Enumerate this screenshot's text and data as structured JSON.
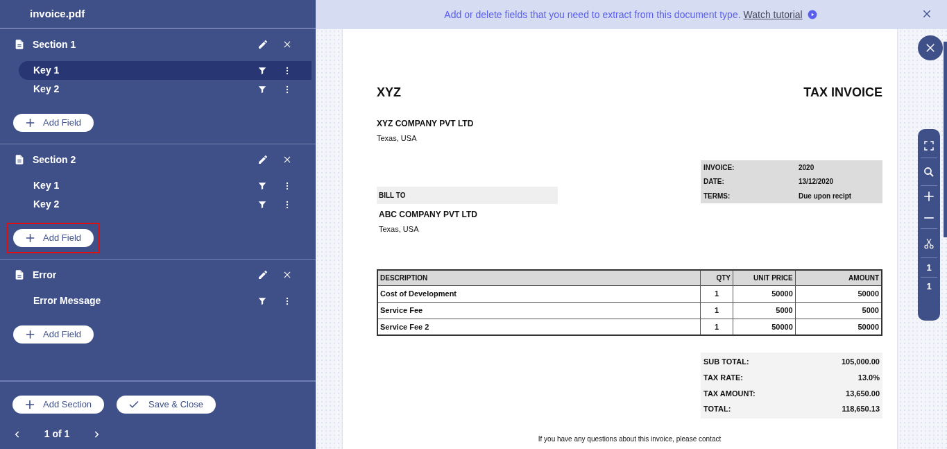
{
  "file_name": "invoice.pdf",
  "sections": [
    {
      "title": "Section 1",
      "keys": [
        {
          "label": "Key 1",
          "selected": true
        },
        {
          "label": "Key 2",
          "selected": false
        }
      ],
      "add_field": {
        "label": "Add Field",
        "highlighted": false
      }
    },
    {
      "title": "Section 2",
      "keys": [
        {
          "label": "Key 1",
          "selected": false
        },
        {
          "label": "Key 2",
          "selected": false
        }
      ],
      "add_field": {
        "label": "Add Field",
        "highlighted": true
      }
    },
    {
      "title": "Error",
      "keys": [
        {
          "label": "Error Message",
          "selected": false
        }
      ],
      "add_field": {
        "label": "Add Field",
        "highlighted": false
      }
    }
  ],
  "footer": {
    "add_section": "Add Section",
    "save_close": "Save & Close",
    "pager": "1 of 1"
  },
  "banner": {
    "message": "Add or delete fields that you need to extract from this document type.",
    "link": "Watch tutorial"
  },
  "toolbar": {
    "page_current": "1",
    "page_total": "1"
  },
  "document": {
    "title": "XYZ",
    "doc_type": "TAX INVOICE",
    "seller": {
      "name": "XYZ COMPANY PVT LTD",
      "address": "Texas, USA"
    },
    "info": [
      {
        "label": "INVOICE:",
        "value": "2020"
      },
      {
        "label": "DATE:",
        "value": "13/12/2020"
      },
      {
        "label": "TERMS:",
        "value": "Due upon recipt"
      }
    ],
    "bill_to": {
      "label": "BILL TO",
      "name": "ABC COMPANY PVT LTD",
      "address": "Texas, USA"
    },
    "table": {
      "columns": [
        "DESCRIPTION",
        "QTY",
        "UNIT PRICE",
        "AMOUNT"
      ],
      "rows": [
        [
          "Cost of Development",
          "1",
          "50000",
          "50000"
        ],
        [
          "Service Fee",
          "1",
          "5000",
          "5000"
        ],
        [
          "Service Fee 2",
          "1",
          "50000",
          "50000"
        ]
      ]
    },
    "totals": [
      {
        "label": "SUB TOTAL:",
        "value": "105,000.00"
      },
      {
        "label": "TAX RATE:",
        "value": "13.0%"
      },
      {
        "label": "TAX AMOUNT:",
        "value": "13,650.00"
      },
      {
        "label": "TOTAL:",
        "value": "118,650.13"
      }
    ],
    "footer_note": "If you have any questions about this invoice, please contact"
  }
}
